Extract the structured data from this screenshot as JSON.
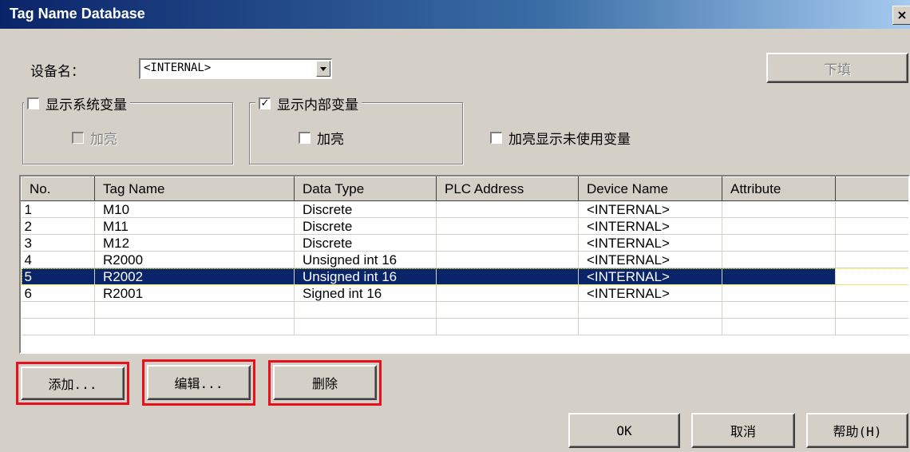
{
  "window": {
    "title": "Tag Name Database",
    "close_glyph": "×"
  },
  "device": {
    "label": "设备名：",
    "value": "<INTERNAL>"
  },
  "fill_button": "下填",
  "groups": {
    "system": {
      "label": "显示系统变量",
      "checked": false,
      "highlight_label": "加亮",
      "highlight_disabled": true
    },
    "internal": {
      "label": "显示内部变量",
      "checked": true,
      "highlight_label": "加亮",
      "highlight_disabled": false
    }
  },
  "highlight_unused": {
    "label": "加亮显示未使用变量",
    "checked": false
  },
  "table": {
    "columns": [
      "No.",
      "Tag Name",
      "Data Type",
      "PLC Address",
      "Device Name",
      "Attribute"
    ],
    "rows": [
      [
        "1",
        "M10",
        "Discrete",
        "",
        "<INTERNAL>",
        ""
      ],
      [
        "2",
        "M11",
        "Discrete",
        "",
        "<INTERNAL>",
        ""
      ],
      [
        "3",
        "M12",
        "Discrete",
        "",
        "<INTERNAL>",
        ""
      ],
      [
        "4",
        "R2000",
        "Unsigned int 16",
        "",
        "<INTERNAL>",
        ""
      ],
      [
        "5",
        "R2002",
        "Unsigned int 16",
        "",
        "<INTERNAL>",
        ""
      ],
      [
        "6",
        "R2001",
        "Signed int 16",
        "",
        "<INTERNAL>",
        ""
      ]
    ],
    "selected_row": 5
  },
  "buttons": {
    "add": "添加...",
    "edit": "编辑...",
    "delete": "删除",
    "ok": "OK",
    "cancel": "取消",
    "help": "帮助(H)"
  },
  "colors": {
    "highlight_box": "#e8101a",
    "selection": "#0a246a",
    "face": "#d4d0c8"
  }
}
